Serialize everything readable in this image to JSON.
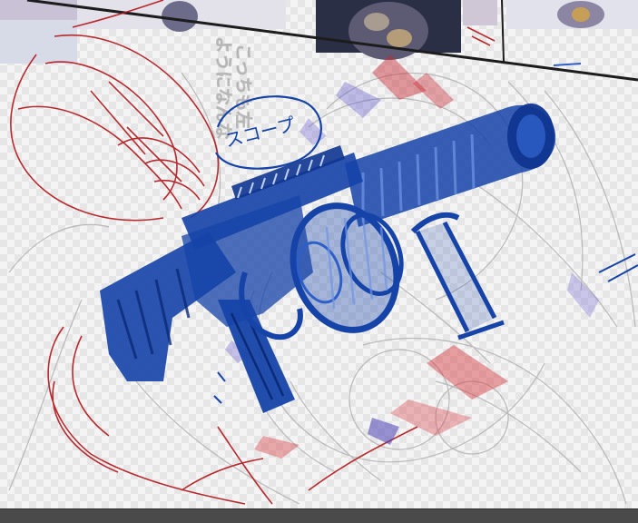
{
  "window": {
    "type": "drawing-canvas",
    "status_text": ""
  },
  "annotations": {
    "handwritten_note_1": "こっちも左",
    "handwritten_note_2": "ようになんな",
    "scope_callout": "スコープ"
  },
  "colors": {
    "canvas_background": "#f4f4f4",
    "checker": "#e6e6e6",
    "sketch_gray": "#a8a8a8",
    "sketch_red": "#b3161b",
    "ink_blue": "#1543a8",
    "status_bar": "#4a4a4a"
  },
  "layers": {
    "reference_photos": "reference-photo-strip",
    "rough_sketch": "gray-rough-sketch",
    "red_sketch": "red-character-sketch",
    "gun_inking": "blue-grenade-launcher-inking"
  }
}
